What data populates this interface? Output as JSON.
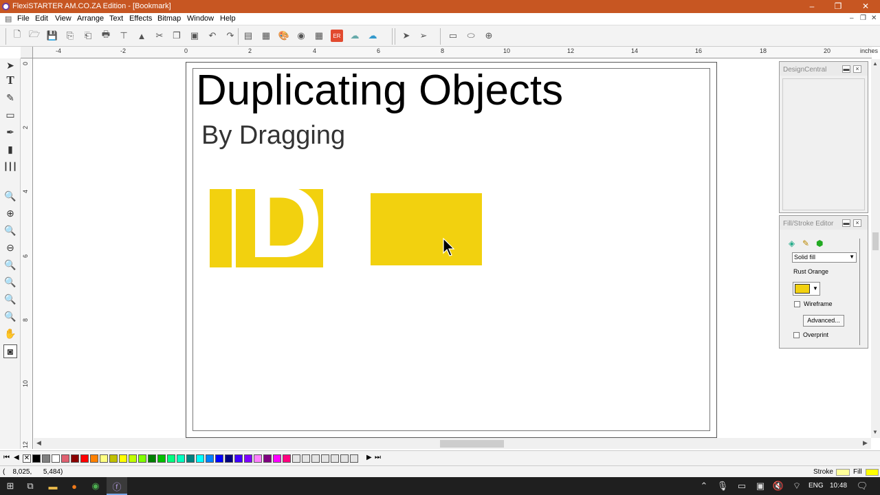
{
  "window": {
    "title": "FlexiSTARTER AM.CO.ZA Edition - [Bookmark]",
    "minimize": "–",
    "maximize": "❐",
    "close": "✕"
  },
  "menu": [
    "File",
    "Edit",
    "View",
    "Arrange",
    "Text",
    "Effects",
    "Bitmap",
    "Window",
    "Help"
  ],
  "ruler": {
    "unit": "inches",
    "h_labels": [
      "-4",
      "-2",
      "0",
      "2",
      "4",
      "6",
      "8",
      "10",
      "12",
      "14",
      "16",
      "18",
      "20"
    ],
    "v_labels": [
      "0",
      "2",
      "4",
      "6",
      "8",
      "10",
      "12"
    ]
  },
  "canvas": {
    "heading": "Duplicating Objects",
    "subheading": "By Dragging",
    "letter": "D",
    "fill_color": "#f2d10f"
  },
  "design_central": {
    "title": "DesignCentral"
  },
  "fill_stroke": {
    "title": "Fill/Stroke Editor",
    "fill_type": "Solid fill",
    "color_name": "Rust Orange",
    "color_hex": "#f2d10f",
    "wireframe_label": "Wireframe",
    "advanced_label": "Advanced...",
    "overprint_label": "Overprint"
  },
  "palette": [
    "#000000",
    "#7f7f7f",
    "#ffffff",
    "#e06070",
    "#8b0000",
    "#ff0000",
    "#ff8000",
    "#ffff80",
    "#c0c000",
    "#ffff00",
    "#c0ff00",
    "#80ff00",
    "#008000",
    "#00c000",
    "#00ff80",
    "#00ffc0",
    "#008080",
    "#00ffff",
    "#0080ff",
    "#0000ff",
    "#000080",
    "#4000ff",
    "#8000ff",
    "#ff80ff",
    "#800080",
    "#ff00ff",
    "#ff0080"
  ],
  "status": {
    "coords": "(    8,025,      5,484)",
    "stroke_label": "Stroke",
    "fill_label": "Fill",
    "stroke_color": "#ffff99",
    "fill_color": "#ffff00"
  },
  "taskbar": {
    "lang": "ENG",
    "time": "10:48"
  }
}
